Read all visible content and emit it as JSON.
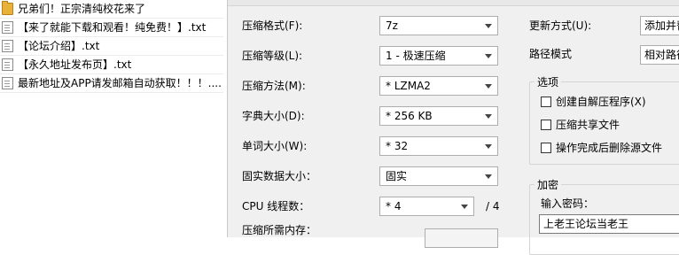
{
  "file_list": {
    "items": [
      {
        "label": "兄弟们！正宗清纯校花来了",
        "icon": "folder-icon"
      },
      {
        "label": "【来了就能下载和观看！纯免费！】.txt",
        "icon": "text-file-icon"
      },
      {
        "label": "【论坛介绍】.txt",
        "icon": "text-file-icon"
      },
      {
        "label": "【永久地址发布页】.txt",
        "icon": "text-file-icon"
      },
      {
        "label": "最新地址及APP请发邮箱自动获取！！！....",
        "icon": "text-file-icon"
      }
    ]
  },
  "dialog": {
    "archive_format": {
      "label": "压缩格式(F):",
      "value": "7z"
    },
    "compression_level": {
      "label": "压缩等级(L):",
      "value": "1 - 极速压缩"
    },
    "compression_method": {
      "label": "压缩方法(M):",
      "value": "* LZMA2"
    },
    "dictionary_size": {
      "label": "字典大小(D):",
      "value": "* 256 KB"
    },
    "word_size": {
      "label": "单词大小(W):",
      "value": "* 32"
    },
    "solid_block_size": {
      "label": "固实数据大小：",
      "value": "固实"
    },
    "cpu_threads": {
      "label": "CPU 线程数：",
      "value": "* 4",
      "max": "/ 4"
    },
    "memory_usage": {
      "label": "压缩所需内存："
    },
    "update_mode": {
      "label": "更新方式(U):",
      "value": "添加并替"
    },
    "path_mode": {
      "label": "路径模式",
      "value": "相对路径"
    },
    "options": {
      "title": "选项",
      "create_sfx": "创建自解压程序(X)",
      "compress_shared": "压缩共享文件",
      "delete_after": "操作完成后删除源文件"
    },
    "encryption": {
      "title": "加密",
      "password_label": "输入密码：",
      "password_value": "上老王论坛当老王"
    }
  }
}
